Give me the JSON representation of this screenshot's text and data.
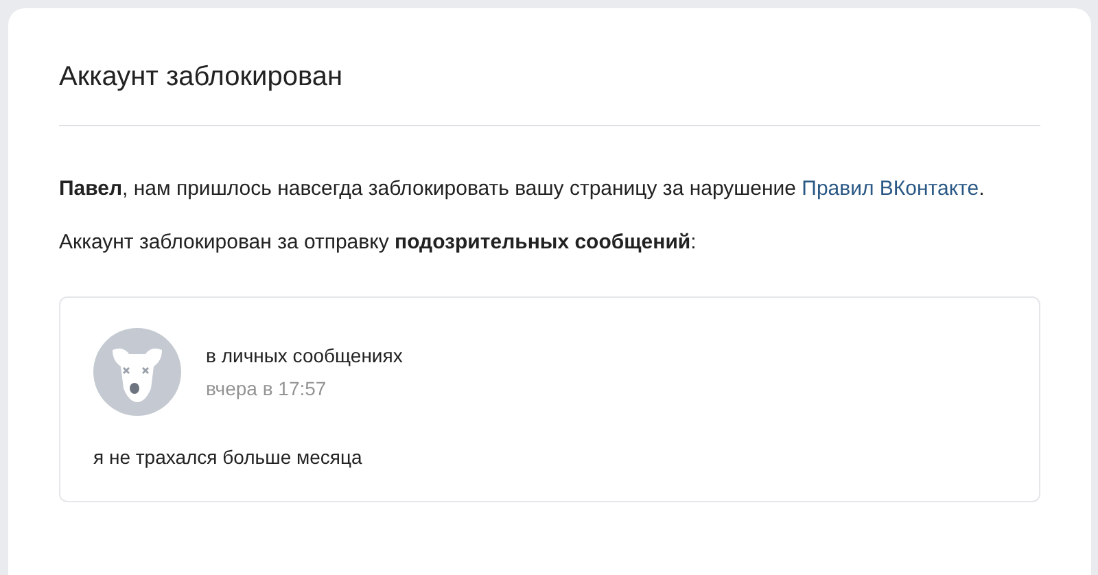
{
  "title": "Аккаунт заблокирован",
  "notice": {
    "text": "**Павел**, нам пришлось навсегда заблокировать вашу страницу за нарушение ",
    "link": "Правил ВКонтакте",
    "after": "."
  },
  "reason": "Аккаунт заблокирован за отправку **подозрительных сообщений**:",
  "message": {
    "source": "в личных сообщениях",
    "time": "вчера в 17:57",
    "text": "я не трахался больше месяца"
  }
}
